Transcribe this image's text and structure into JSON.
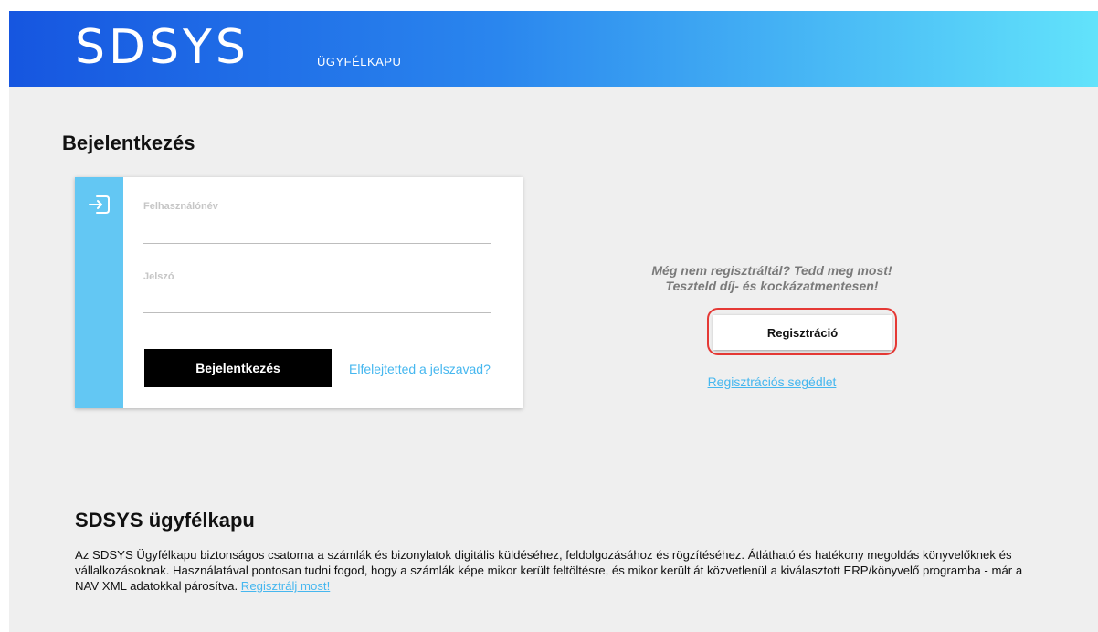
{
  "header": {
    "logo": "SDSYS",
    "logo_sub": "ÜGYFÉLKAPU"
  },
  "login": {
    "title": "Bejelentkezés",
    "username_label": "Felhasználónév",
    "username_value": "",
    "password_label": "Jelszó",
    "password_value": "",
    "submit_label": "Bejelentkezés",
    "forgot_label": "Elfelejtetted a jelszavad?"
  },
  "register": {
    "promo_line1": "Még nem regisztráltál? Tedd meg most!",
    "promo_line2": "Teszteld díj- és kockázatmentesen!",
    "button_label": "Regisztráció",
    "help_link": "Regisztrációs segédlet"
  },
  "about": {
    "title": "SDSYS ügyfélkapu",
    "text": "Az SDSYS Ügyfélkapu biztonságos csatorna a számlák és bizonylatok digitális küldéséhez, feldolgozásához és rögzítéséhez. Átlátható és hatékony megoldás könyvelőknek és vállalkozásoknak. Használatával pontosan tudni fogod, hogy a számlák képe mikor került feltöltésre, és mikor került át közvetlenül a kiválasztott ERP/könyvelő programba - már a NAV XML adatokkal párosítva.",
    "link": "Regisztrálj most!"
  },
  "colors": {
    "header_gradient_start": "#1656e0",
    "header_gradient_end": "#62e3fb",
    "accent_blue": "#46b7ef",
    "card_stripe": "#63c7f3",
    "highlight_red": "#e53935",
    "background": "#efefef"
  },
  "icons": {
    "login": "login-arrow-icon"
  }
}
